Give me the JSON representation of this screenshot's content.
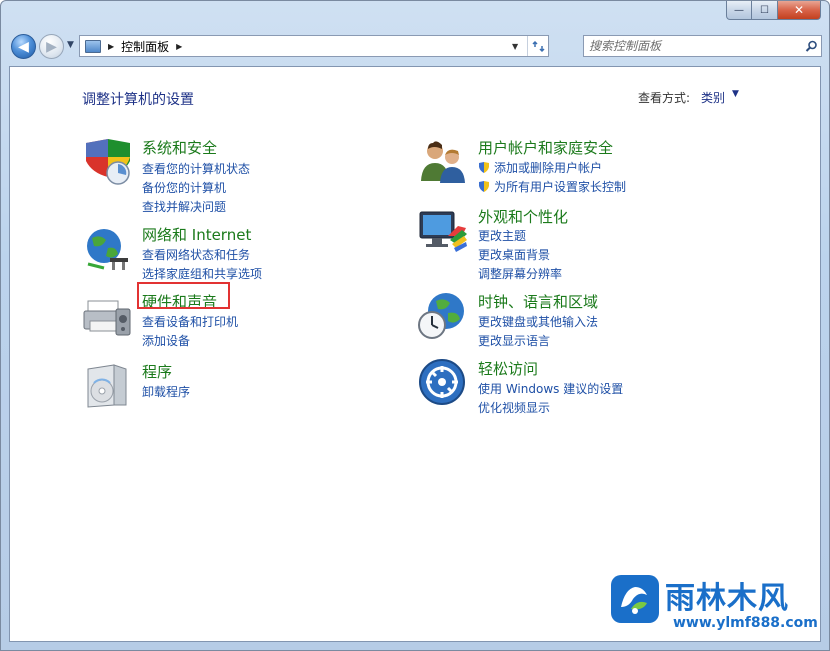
{
  "window": {
    "min_label": "—",
    "max_label": "☐",
    "close_label": "✕"
  },
  "nav": {
    "breadcrumb": "控制面板",
    "search_placeholder": "搜索控制面板"
  },
  "page": {
    "title": "调整计算机的设置",
    "viewby_label": "查看方式:",
    "viewby_value": "类别"
  },
  "categories": [
    {
      "title": "系统和安全",
      "links": [
        "查看您的计算机状态",
        "备份您的计算机",
        "查找并解决问题"
      ]
    },
    {
      "title": "网络和 Internet",
      "links": [
        "查看网络状态和任务",
        "选择家庭组和共享选项"
      ]
    },
    {
      "title": "硬件和声音",
      "links": [
        "查看设备和打印机",
        "添加设备"
      ]
    },
    {
      "title": "程序",
      "links": [
        "卸载程序"
      ]
    },
    {
      "title": "用户帐户和家庭安全",
      "links": [
        "添加或删除用户帐户",
        "为所有用户设置家长控制"
      ]
    },
    {
      "title": "外观和个性化",
      "links": [
        "更改主题",
        "更改桌面背景",
        "调整屏幕分辨率"
      ]
    },
    {
      "title": "时钟、语言和区域",
      "links": [
        "更改键盘或其他输入法",
        "更改显示语言"
      ]
    },
    {
      "title": "轻松访问",
      "links": [
        "使用 Windows 建议的设置",
        "优化视频显示"
      ]
    }
  ],
  "watermark": {
    "name": "雨林木风",
    "url": "www.ylmf888.com"
  },
  "colors": {
    "category_title": "#1b7a1b",
    "link": "#1f50a6",
    "highlight": "#e23232",
    "watermark": "#1a6fc9"
  }
}
